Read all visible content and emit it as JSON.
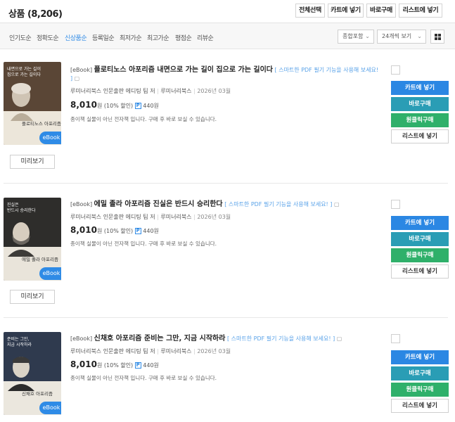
{
  "header": {
    "title": "상품 (8,206)",
    "buttons": [
      "전체선택",
      "카트에 넣기",
      "바로구매",
      "리스트에 넣기"
    ]
  },
  "sortbar": {
    "options": [
      "인기도순",
      "정확도순",
      "신상품순",
      "등록일순",
      "최저가순",
      "최고가순",
      "평점순",
      "리뷰순"
    ],
    "active": "신상품순",
    "filter_select": "종합포함",
    "per_page_select": "24개씩 보기"
  },
  "items": [
    {
      "cover_text": "내면으로 가는 길이\n집으로 가는 길이다",
      "cover_title": "플로티노스 아포리즘",
      "badge": "eBook",
      "preview": "미리보기",
      "tag": "[eBook]",
      "title": "플로티노스 아포리즘 내면으로 가는 길이 집으로 가는 길이다",
      "pdf_note": "[ 스마트한 PDF 필기 기능을 사용해 보세요! ]",
      "author": "루미너리북스 인문출판 에디팅 팀 저",
      "publisher": "루미너리북스",
      "date": "2026년 03월",
      "price": "8,010",
      "price_unit": "원",
      "discount": "(10% 할인)",
      "points_badge": "P",
      "points": "440원",
      "desc": "종이책 실물이 아닌 전자책 입니다. 구매 후 바로 보실 수 있습니다.",
      "actions": [
        "카트에 넣기",
        "바로구매",
        "원클릭구매",
        "리스트에 넣기"
      ],
      "cover_color": "#5a4636"
    },
    {
      "cover_text": "진실은\n반드시 승리한다",
      "cover_title": "에밀 졸라 아포리즘",
      "badge": "eBook",
      "preview": "미리보기",
      "tag": "[eBook]",
      "title": "에밀 졸라 아포리즘 진실은 반드시 승리한다",
      "pdf_note": "[ 스마트한 PDF 필기 기능을 사용해 보세요! ]",
      "author": "루미너리북스 인문출판 에디팅 팀 저",
      "publisher": "루미너리북스",
      "date": "2026년 03월",
      "price": "8,010",
      "price_unit": "원",
      "discount": "(10% 할인)",
      "points_badge": "P",
      "points": "440원",
      "desc": "종이책 실물이 아닌 전자책 입니다. 구매 후 바로 보실 수 있습니다.",
      "actions": [
        "카트에 넣기",
        "바로구매",
        "원클릭구매",
        "리스트에 넣기"
      ],
      "cover_color": "#2e2d2b"
    },
    {
      "cover_text": "준비는 그만,\n지금 시작하라",
      "cover_title": "신채호 아포리즘",
      "badge": "eBook",
      "preview": "미리보기",
      "tag": "[eBook]",
      "title": "신채호 아포리즘 준비는 그만, 지금 시작하라",
      "pdf_note": "[ 스마트한 PDF 필기 기능을 사용해 보세요! ]",
      "author": "루미너리북스 인문출판 에디팅 팀 저",
      "publisher": "루미너리북스",
      "date": "2026년 03월",
      "price": "8,010",
      "price_unit": "원",
      "discount": "(10% 할인)",
      "points_badge": "P",
      "points": "440원",
      "desc": "종이책 실물이 아닌 전자책 입니다. 구매 후 바로 보실 수 있습니다.",
      "actions": [
        "카트에 넣기",
        "바로구매",
        "원클릭구매",
        "리스트에 넣기"
      ],
      "cover_color": "#2f3a4e"
    }
  ],
  "colors": {
    "accent_blue": "#2b87e3",
    "teal": "#2a9db5",
    "green": "#2fb06a",
    "active_sort": "#2f8be6"
  }
}
